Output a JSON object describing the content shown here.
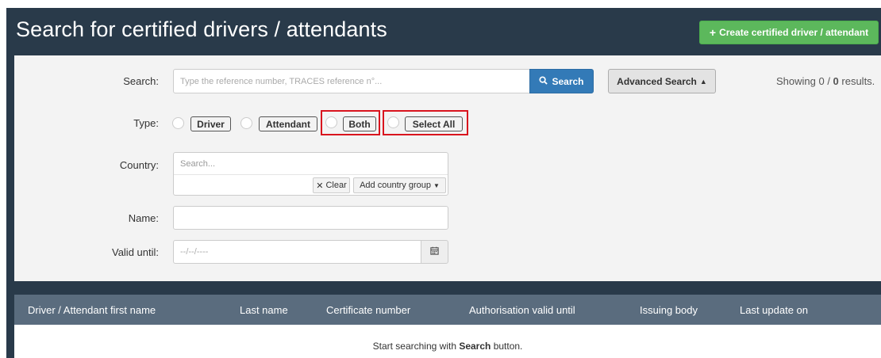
{
  "header": {
    "title": "Search for certified drivers / attendants",
    "create_button": "Create certified driver / attendant",
    "create_icon": "plus-icon"
  },
  "form": {
    "search_label": "Search:",
    "search_placeholder": "Type the reference number, TRACES reference n°...",
    "search_button": "Search",
    "advanced_button": "Advanced Search",
    "type_label": "Type:",
    "type_options": [
      "Driver",
      "Attendant",
      "Both",
      "Select All"
    ],
    "country_label": "Country:",
    "country_placeholder": "Search...",
    "clear_button": "Clear",
    "country_group_button": "Add country group",
    "name_label": "Name:",
    "name_value": "",
    "valid_until_label": "Valid until:",
    "valid_until_placeholder": "--/--/----"
  },
  "results": {
    "showing_prefix": "Showing 0 / ",
    "showing_total": "0",
    "showing_suffix": " results."
  },
  "table": {
    "columns": [
      "Driver / Attendant first name",
      "Last name",
      "Certificate number",
      "Authorisation valid until",
      "Issuing body",
      "Last update on"
    ],
    "empty_prefix": "Start searching with ",
    "empty_bold": "Search",
    "empty_suffix": " button."
  },
  "colors": {
    "header_bg": "#293a4a",
    "create_green": "#5cb85c",
    "search_blue": "#337ab7",
    "highlight_red": "#d9141e",
    "table_header": "#5a6c7e"
  }
}
